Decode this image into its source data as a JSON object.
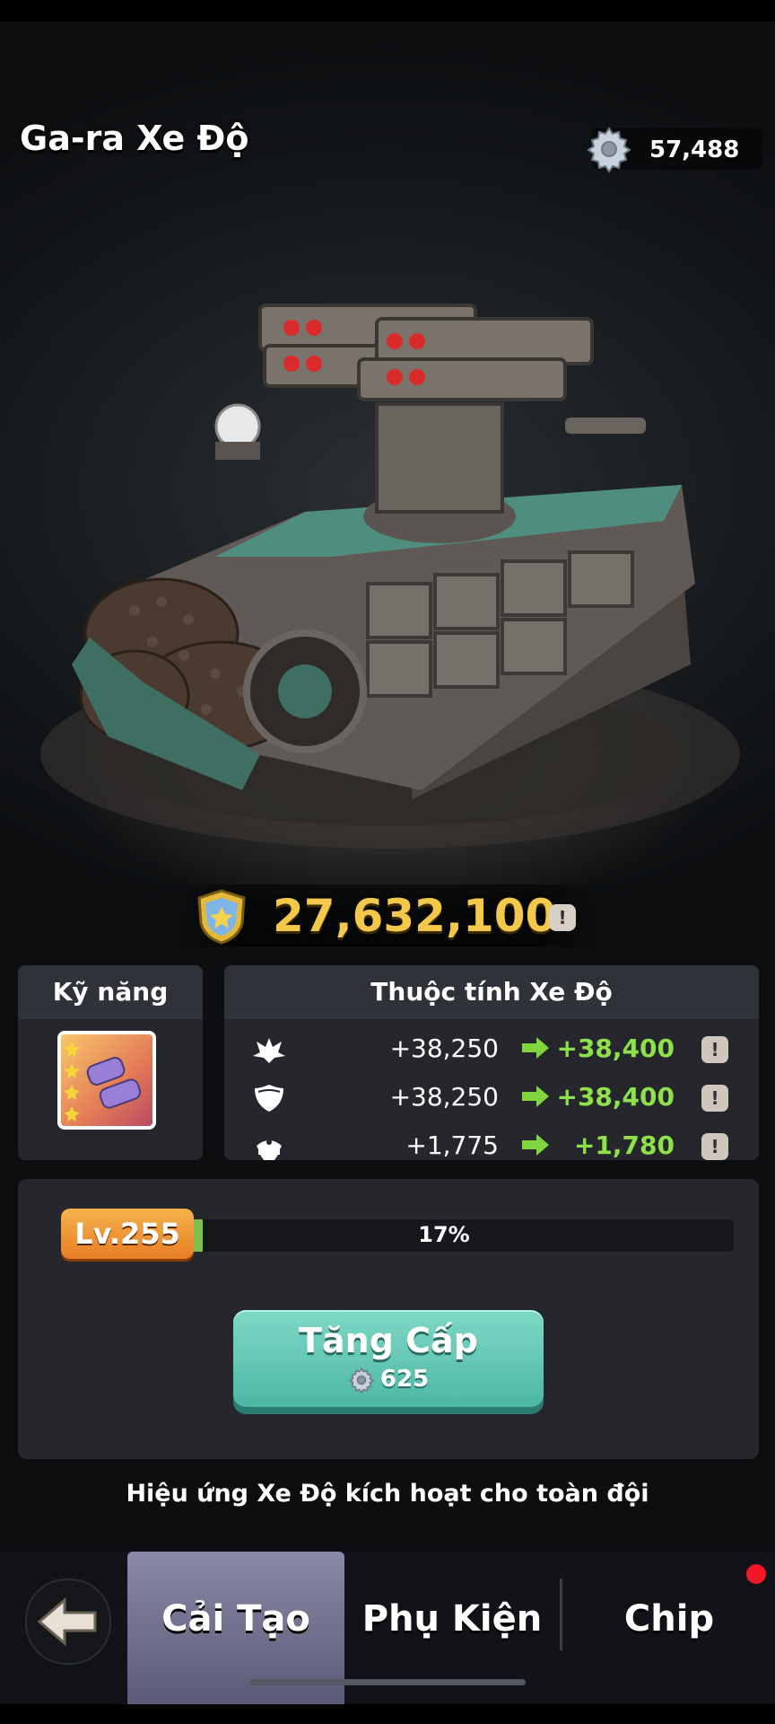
{
  "header": {
    "title": "Ga-ra Xe Độ",
    "currency_value": "57,488"
  },
  "power": {
    "value": "27,632,100",
    "info_label": "!"
  },
  "skills": {
    "title": "Kỹ năng"
  },
  "attributes": {
    "title": "Thuộc tính Xe Độ",
    "rows": [
      {
        "icon": "attack-icon",
        "current": "+38,250",
        "next": "+38,400",
        "info_label": "!"
      },
      {
        "icon": "defense-icon",
        "current": "+38,250",
        "next": "+38,400",
        "info_label": "!"
      },
      {
        "icon": "commander-hat-icon",
        "current": "+1,775",
        "next": "+1,780",
        "info_label": "!"
      }
    ]
  },
  "level": {
    "label": "Lv.255",
    "percent_text": "17%",
    "progress": 0.17
  },
  "upgrade": {
    "label": "Tăng Cấp",
    "cost": "625"
  },
  "team_note": "Hiệu ứng Xe Độ kích hoạt cho toàn đội",
  "tabs": [
    {
      "label": "Cải Tạo",
      "active": true
    },
    {
      "label": "Phụ Kiện",
      "active": false
    },
    {
      "label": "Chip",
      "active": false,
      "notification": true
    }
  ],
  "colors": {
    "accent_gold": "#f4c84b",
    "accent_green": "#8ee14a",
    "upgrade_teal": "#4db7a4",
    "level_orange": "#e77d25",
    "notification_red": "#f2182a"
  }
}
